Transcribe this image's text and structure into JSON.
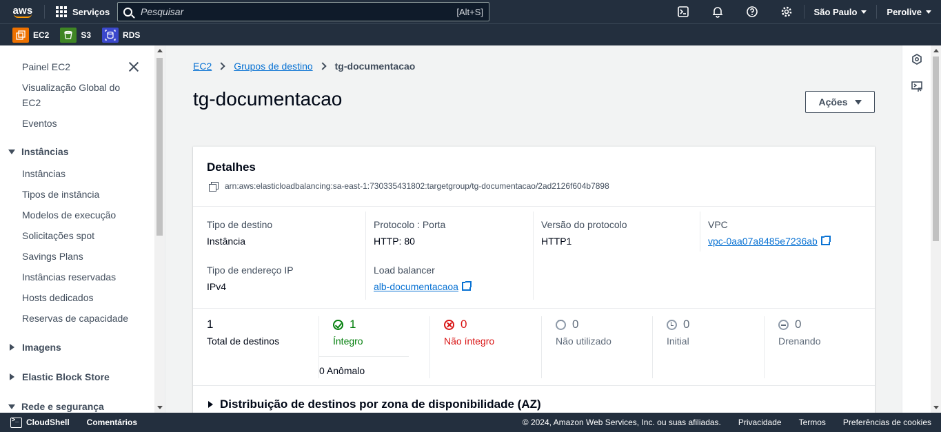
{
  "topnav": {
    "logo_text": "aws",
    "services_label": "Serviços",
    "search_placeholder": "Pesquisar",
    "search_shortcut": "[Alt+S]",
    "region_label": "São Paulo",
    "account_label": "Perolive"
  },
  "favorites": [
    {
      "label": "EC2",
      "color": "#ed7100"
    },
    {
      "label": "S3",
      "color": "#3f8624"
    },
    {
      "label": "RDS",
      "color": "#3b48cc"
    }
  ],
  "sidebar": {
    "top_items": [
      "Painel EC2",
      "Visualização Global do",
      "EC2",
      "Eventos"
    ],
    "instances_section": "Instâncias",
    "instances_items": [
      "Instâncias",
      "Tipos de instância",
      "Modelos de execução",
      "Solicitações spot",
      "Savings Plans",
      "Instâncias reservadas",
      "Hosts dedicados",
      "Reservas de capacidade"
    ],
    "images_section": "Imagens",
    "ebs_section": "Elastic Block Store",
    "network_section": "Rede e segurança"
  },
  "breadcrumb": {
    "items": [
      "EC2",
      "Grupos de destino"
    ],
    "current": "tg-documentacao"
  },
  "page": {
    "title": "tg-documentacao",
    "actions_label": "Ações"
  },
  "details": {
    "heading": "Detalhes",
    "arn": "arn:aws:elasticloadbalancing:sa-east-1:730335431802:targetgroup/tg-documentacao/2ad2126f604b7898",
    "target_type_label": "Tipo de destino",
    "target_type_value": "Instância",
    "protocol_port_label": "Protocolo : Porta",
    "protocol_port_value": "HTTP: 80",
    "protocol_version_label": "Versão do protocolo",
    "protocol_version_value": "HTTP1",
    "vpc_label": "VPC",
    "vpc_value": "vpc-0aa07a8485e7236ab",
    "ip_type_label": "Tipo de endereço IP",
    "ip_type_value": "IPv4",
    "lb_label": "Load balancer",
    "lb_value": "alb-documentacaoa"
  },
  "stats": {
    "total_value": "1",
    "total_label": "Total de destinos",
    "healthy_value": "1",
    "healthy_label": "Íntegro",
    "anomalous_label": "0 Anômalo",
    "unhealthy_value": "0",
    "unhealthy_label": "Não íntegro",
    "unused_value": "0",
    "unused_label": "Não utilizado",
    "initial_value": "0",
    "initial_label": "Initial",
    "draining_value": "0",
    "draining_label": "Drenando"
  },
  "az_section": "Distribuição de destinos por zona de disponibilidade (AZ)",
  "footer": {
    "cloudshell": "CloudShell",
    "feedback": "Comentários",
    "copyright": "© 2024, Amazon Web Services, Inc. ou suas afiliadas.",
    "privacy": "Privacidade",
    "terms": "Termos",
    "cookies": "Preferências de cookies"
  }
}
